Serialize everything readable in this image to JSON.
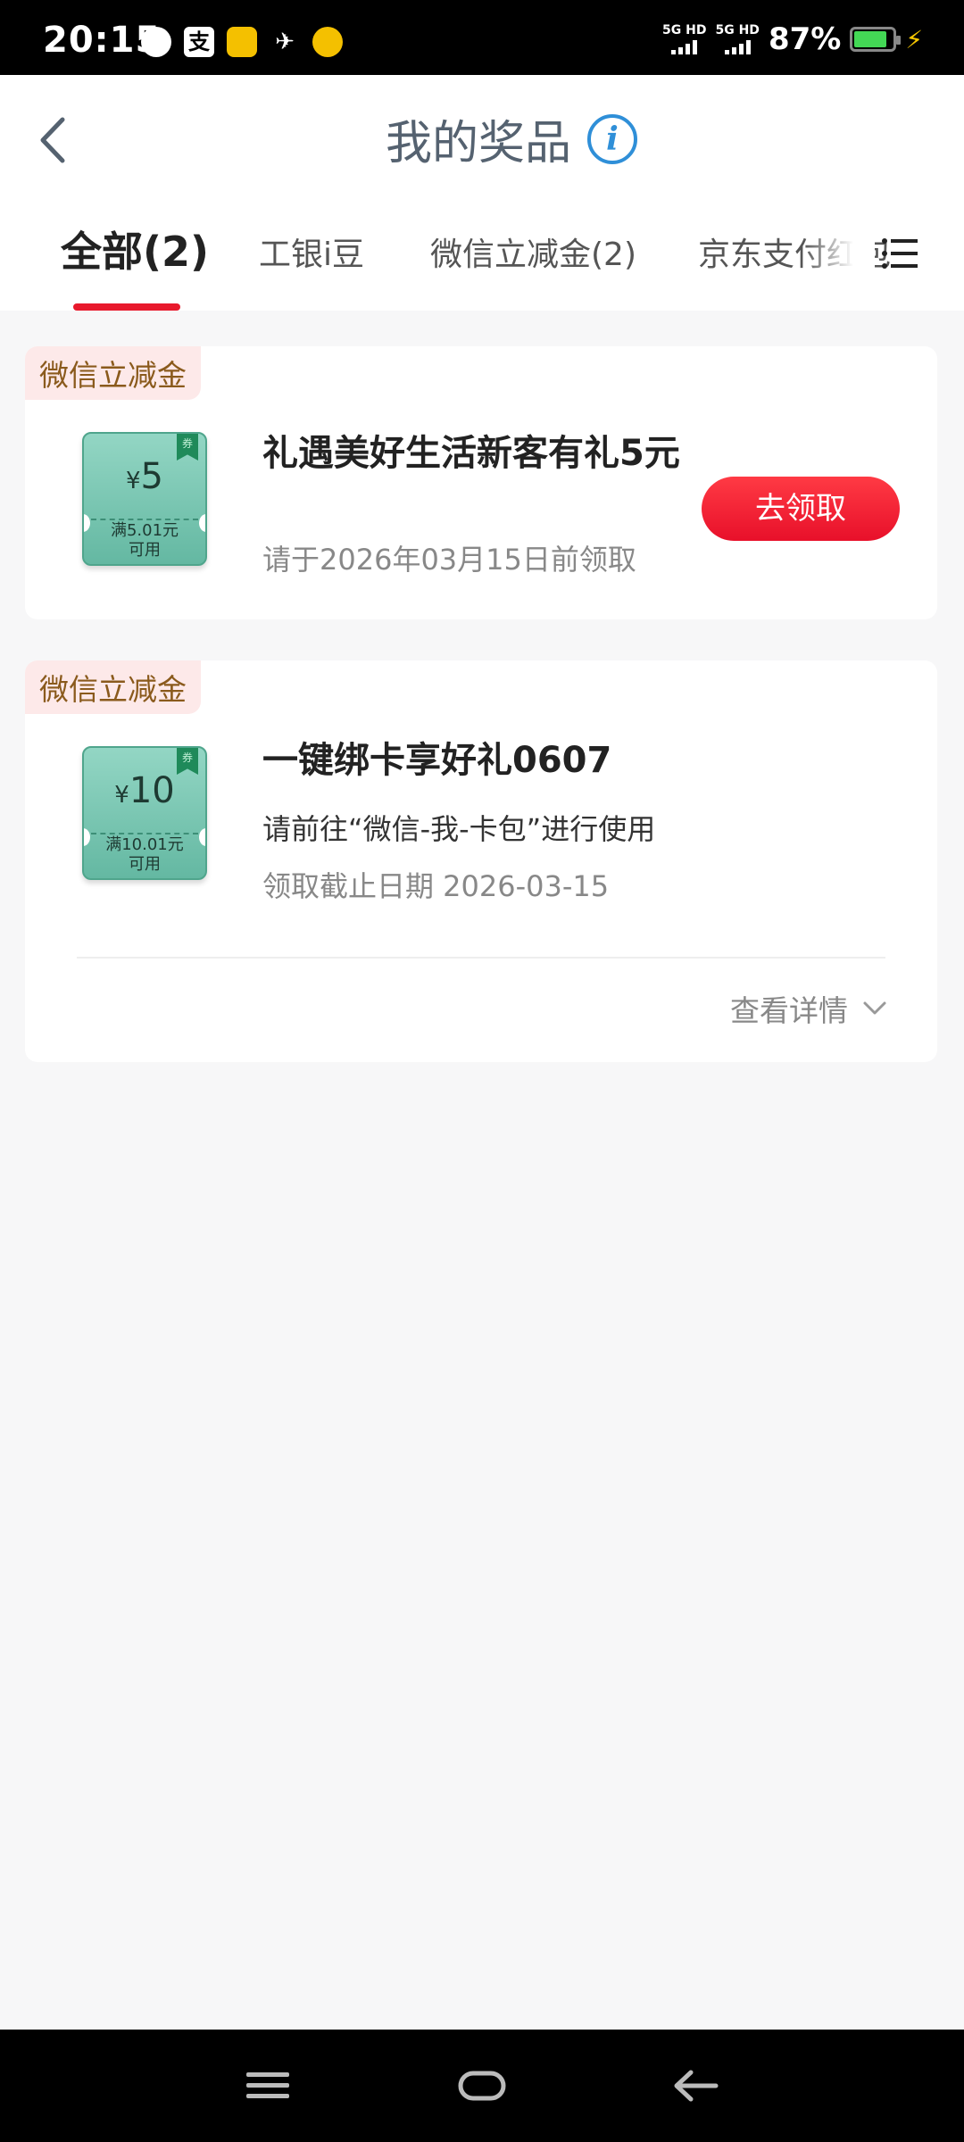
{
  "status_bar": {
    "time": "20:15",
    "pay_glyph": "支",
    "net1": "5G HD",
    "net2": "5G HD",
    "battery_text": "87%",
    "battery_level": 0.87,
    "icons": [
      "message-icon",
      "alipay-icon",
      "app-icon",
      "bird-icon",
      "coin-icon",
      "signal-icon",
      "battery-icon",
      "charging-icon"
    ]
  },
  "header": {
    "title": "我的奖品",
    "info_glyph": "i"
  },
  "tabs": [
    {
      "label": "全部(2)",
      "active": true
    },
    {
      "label": "工银i豆",
      "active": false
    },
    {
      "label": "微信立减金(2)",
      "active": false
    },
    {
      "label": "京东支付红包",
      "active": false
    }
  ],
  "prizes": [
    {
      "tag": "微信立减金",
      "voucher": {
        "currency": "¥",
        "amount": "5",
        "condition_line1": "满5.01元",
        "condition_line2": "可用",
        "ribbon": "券"
      },
      "title": "礼遇美好生活新客有礼5元",
      "subtitle": "请于2026年03月15日前领取",
      "action": "去领取"
    },
    {
      "tag": "微信立减金",
      "voucher": {
        "currency": "¥",
        "amount": "10",
        "condition_line1": "满10.01元",
        "condition_line2": "可用",
        "ribbon": "券"
      },
      "title": "一键绑卡享好礼0607",
      "description": "请前往“微信-我-卡包”进行使用",
      "subtitle": "领取截止日期 2026-03-15",
      "detail_link": "查看详情"
    }
  ],
  "colors": {
    "accent": "#e8192c",
    "voucher": "#7cc8b3",
    "tag_text": "#8a5a1c",
    "info": "#2f8fd8"
  }
}
